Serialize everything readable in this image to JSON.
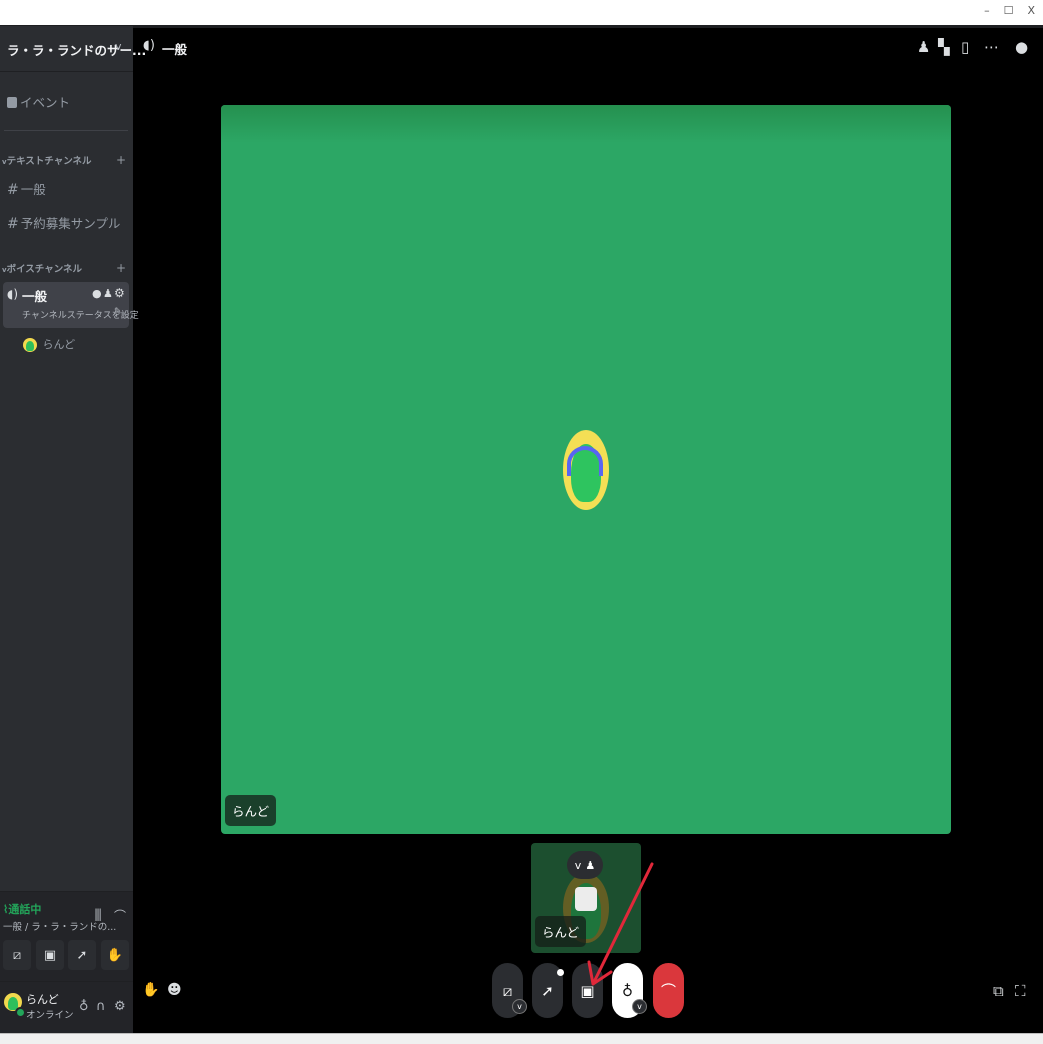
{
  "window": {
    "controls": [
      "–",
      "☐",
      "X"
    ]
  },
  "sidebar": {
    "server_name": "ラ・ラ・ランドのサー...",
    "events_label": "イベント",
    "text_category": "テキストチャンネル",
    "text_channels": [
      {
        "name": "一般"
      },
      {
        "name": "予約募集サンプル"
      }
    ],
    "voice_category": "ボイスチャンネル",
    "voice_channel": {
      "name": "一般",
      "status_label": "チャンネルステータスを設定"
    },
    "voice_user": "らんど"
  },
  "voice_panel": {
    "status": "通話中",
    "location": "一般 / ラ・ラ・ランドの..."
  },
  "user_panel": {
    "name": "らんど",
    "status": "オンライン"
  },
  "main": {
    "channel_name": "一般",
    "stage_user_label": "らんど",
    "thumbnail_user_label": "らんど"
  },
  "colors": {
    "stage": "#2ca765",
    "sidebar": "#2b2d31",
    "accent_red": "#da373c",
    "online_green": "#23a55a",
    "arrow_annotation": "#e0283a"
  },
  "icons": [
    "calendar-icon",
    "hash-icon",
    "speaker-icon",
    "settings-icon",
    "add-user-icon",
    "grid-icon",
    "popout-icon",
    "more-icon",
    "camera-off-icon",
    "activity-icon",
    "screen-share-icon",
    "mic-icon",
    "disconnect-icon",
    "soundboard-icon",
    "emoji-icon",
    "headphones-icon",
    "fullscreen-icon"
  ]
}
